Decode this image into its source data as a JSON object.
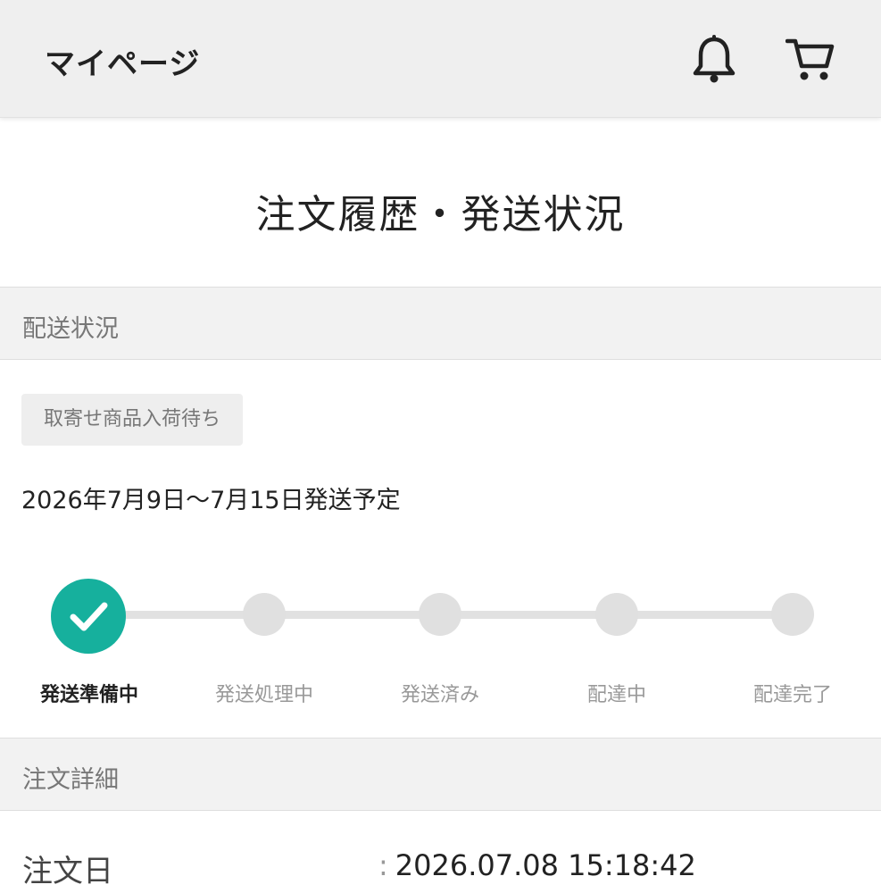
{
  "header": {
    "title": "マイページ",
    "icons": [
      "bell-icon",
      "cart-icon"
    ]
  },
  "page_title": "注文履歴・発送状況",
  "shipping": {
    "section_label": "配送状況",
    "status_badge": "取寄せ商品入荷待ち",
    "schedule_text": "2026年7月9日〜7月15日発送予定",
    "current_step": 1,
    "steps": [
      {
        "label": "発送準備中"
      },
      {
        "label": "発送処理中"
      },
      {
        "label": "発送済み"
      },
      {
        "label": "配達中"
      },
      {
        "label": "配達完了"
      }
    ]
  },
  "order": {
    "section_label": "注文詳細",
    "rows": [
      {
        "key": "注文日",
        "colon": ":",
        "value": "2026.07.08 15:18:42"
      }
    ]
  },
  "colors": {
    "accent": "#16b09d",
    "inactive": "#e0e0e0"
  }
}
